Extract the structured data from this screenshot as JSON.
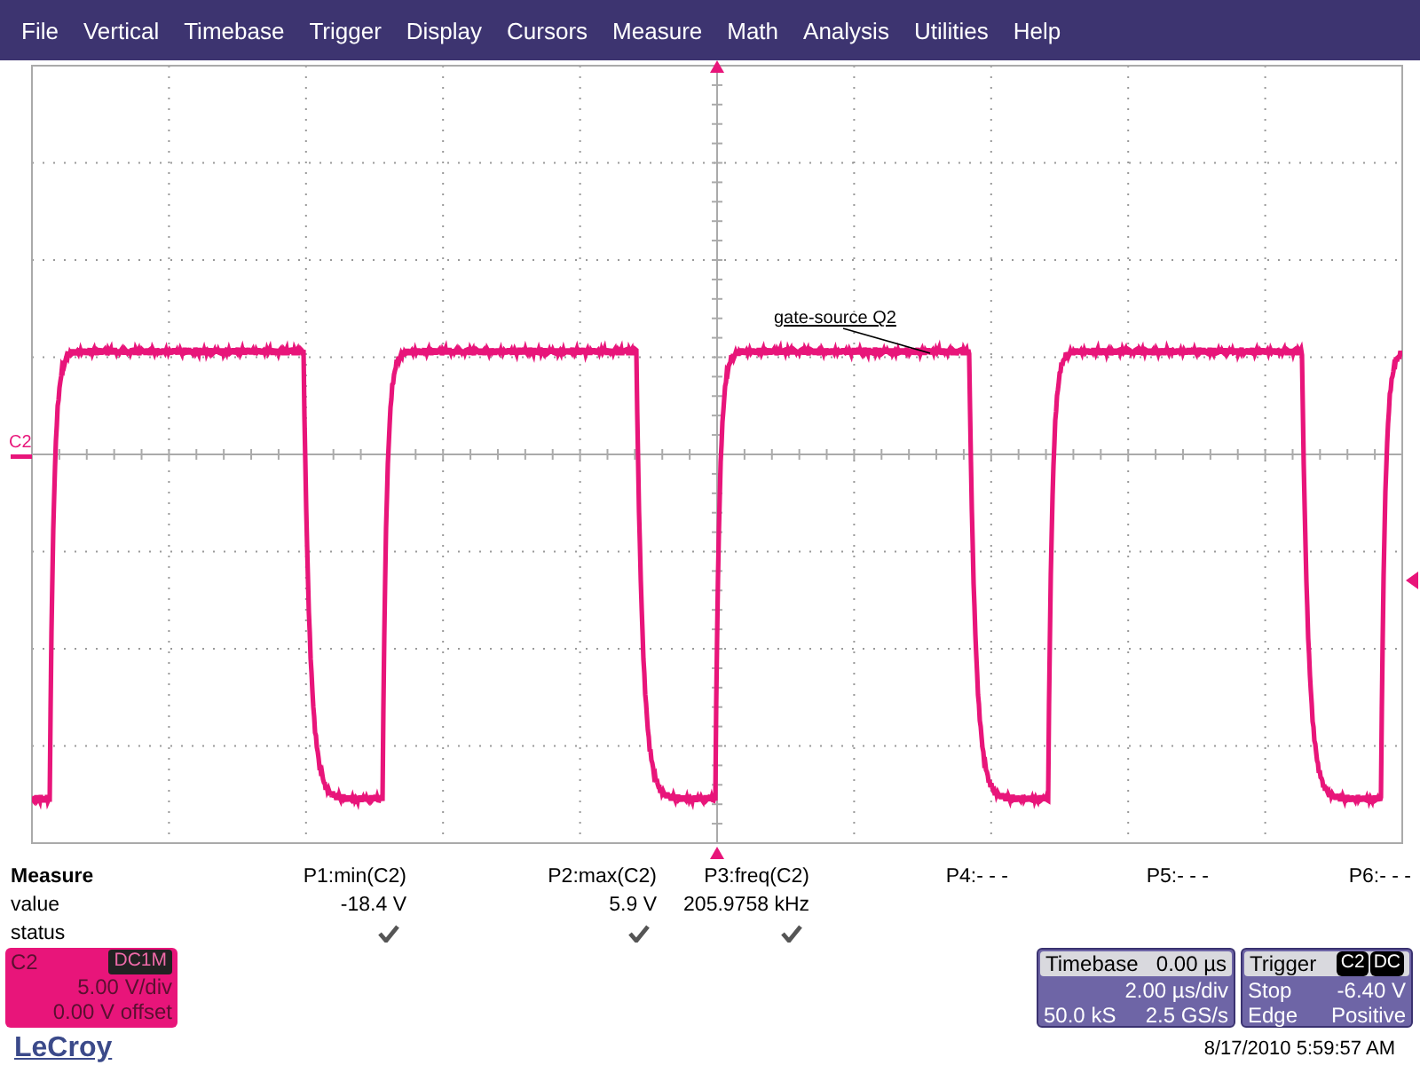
{
  "menu": [
    "File",
    "Vertical",
    "Timebase",
    "Trigger",
    "Display",
    "Cursors",
    "Measure",
    "Math",
    "Analysis",
    "Utilities",
    "Help"
  ],
  "screen": {
    "channel_label": "C2",
    "annotation": "gate-source Q2"
  },
  "measure": {
    "title": "Measure",
    "row_labels": [
      "value",
      "status"
    ],
    "params": [
      {
        "header": "P1:min(C2)",
        "value": "-18.4 V",
        "checked": true
      },
      {
        "header": "P2:max(C2)",
        "value": "5.9 V",
        "checked": true
      },
      {
        "header": "P3:freq(C2)",
        "value": "205.9758 kHz",
        "checked": true
      },
      {
        "header": "P4:- - -",
        "checked": false
      },
      {
        "header": "P5:- - -",
        "checked": false
      },
      {
        "header": "P6:- - -",
        "checked": false
      }
    ]
  },
  "channel": {
    "name": "C2",
    "coupling": "DC1M",
    "scale": "5.00 V/div",
    "offset": "0.00 V offset",
    "color": "#e8157a"
  },
  "timebase": {
    "title": "Timebase",
    "delay": "0.00 µs",
    "scale": "2.00 µs/div",
    "samples": "50.0 kS",
    "rate": "2.5 GS/s"
  },
  "trigger": {
    "title": "Trigger",
    "badges": [
      "C2",
      "DC"
    ],
    "mode": "Stop",
    "level": "-6.40 V",
    "type": "Edge",
    "slope": "Positive"
  },
  "logo": "LeCroy",
  "timestamp": "8/17/2010 5:59:57 AM"
}
